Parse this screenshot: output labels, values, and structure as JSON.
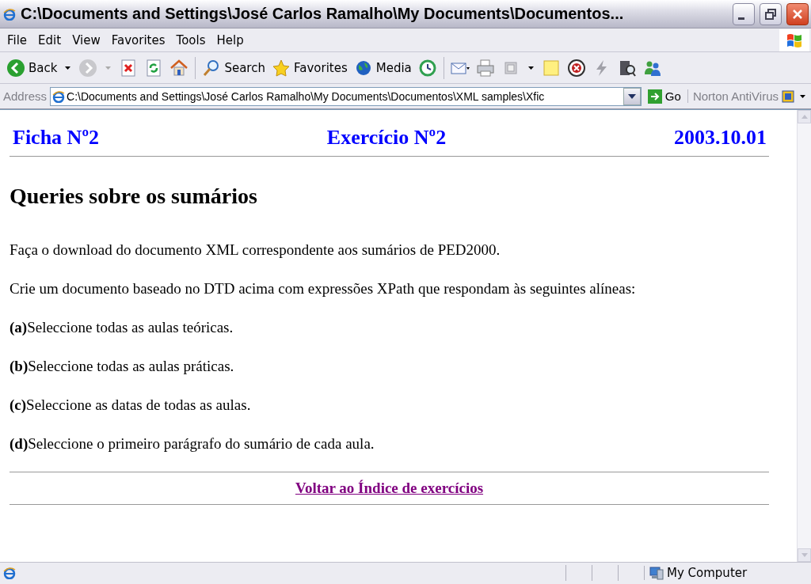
{
  "window": {
    "title": "C:\\Documents and Settings\\José Carlos Ramalho\\My Documents\\Documentos..."
  },
  "menu": [
    "File",
    "Edit",
    "View",
    "Favorites",
    "Tools",
    "Help"
  ],
  "toolbar": [
    {
      "kind": "back",
      "label": "Back"
    },
    {
      "kind": "forward"
    },
    {
      "kind": "stop"
    },
    {
      "kind": "refresh"
    },
    {
      "kind": "home"
    },
    {
      "kind": "search",
      "label": "Search"
    },
    {
      "kind": "favorites",
      "label": "Favorites"
    },
    {
      "kind": "media",
      "label": "Media"
    },
    {
      "kind": "history"
    },
    {
      "kind": "mail"
    },
    {
      "kind": "print"
    },
    {
      "kind": "edit"
    },
    {
      "kind": "note"
    },
    {
      "kind": "block"
    },
    {
      "kind": "bolt"
    },
    {
      "kind": "research"
    },
    {
      "kind": "messenger"
    }
  ],
  "address": {
    "label": "Address",
    "value": "C:\\Documents and Settings\\José Carlos Ramalho\\My Documents\\Documentos\\XML samples\\Xfic",
    "go": "Go",
    "extra": "Norton AntiVirus"
  },
  "page": {
    "header": [
      "Ficha Nº2",
      "Exercício Nº2",
      "2003.10.01"
    ],
    "heading": "Queries sobre os sumários",
    "paragraphs": [
      "Faça o download do documento XML correspondente aos sumários de PED2000.",
      "Crie um documento baseado no DTD acima com expressões XPath que respondam às seguintes alíneas:"
    ],
    "items": [
      {
        "mark": "(a)",
        "text": "Seleccione todas as aulas teóricas."
      },
      {
        "mark": "(b)",
        "text": "Seleccione todas as aulas práticas."
      },
      {
        "mark": "(c)",
        "text": "Seleccione as datas de todas as aulas."
      },
      {
        "mark": "(d)",
        "text": "Seleccione o primeiro parágrafo do sumário de cada aula."
      }
    ],
    "link": "Voltar ao Índice de exercícios"
  },
  "status_bar": {
    "zone": "My Computer"
  }
}
